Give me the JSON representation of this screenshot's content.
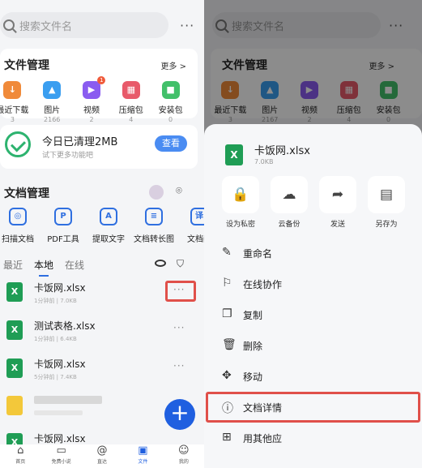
{
  "left": {
    "search_placeholder": "搜索文件名",
    "more_dots": "···",
    "file_mgmt": {
      "title": "文件管理",
      "more": "更多 >",
      "tiles": [
        {
          "label": "最近下载",
          "count": "3",
          "color": "#f08a3a",
          "icon": "download-icon",
          "glyph": "↓"
        },
        {
          "label": "图片",
          "count": "2166",
          "color": "#3a9ef0",
          "icon": "image-icon",
          "glyph": "▲"
        },
        {
          "label": "视频",
          "count": "2",
          "color": "#8a5cf0",
          "icon": "play-icon",
          "glyph": "▶",
          "badge": "1"
        },
        {
          "label": "压缩包",
          "count": "4",
          "color": "#e85a6a",
          "icon": "zip-icon",
          "glyph": "▦"
        },
        {
          "label": "安装包",
          "count": "0",
          "color": "#42c06a",
          "icon": "package-icon",
          "glyph": "■"
        }
      ]
    },
    "clean": {
      "title": "今日已清理2MB",
      "subtitle": "试下更多功能吧",
      "button": "查看"
    },
    "doc_mgmt": {
      "title": "文档管理",
      "tools": [
        {
          "label": "扫描文档",
          "icon": "camera-icon",
          "glyph": "◎"
        },
        {
          "label": "PDF工具",
          "icon": "pdf-icon",
          "glyph": "P"
        },
        {
          "label": "提取文字",
          "icon": "text-extract-icon",
          "glyph": "A"
        },
        {
          "label": "文档转长图",
          "icon": "doc-to-image-icon",
          "glyph": "≡"
        },
        {
          "label": "文档翻",
          "icon": "translate-icon",
          "glyph": "译"
        }
      ]
    },
    "tabs": [
      "最近",
      "本地",
      "在线"
    ],
    "files": [
      {
        "name": "卡饭网.xlsx",
        "meta": "1分钟前  |  7.0KB"
      },
      {
        "name": "测试表格.xlsx",
        "meta": "1分钟前  |  6.4KB"
      },
      {
        "name": "卡饭网.xlsx",
        "meta": "5分钟前  |  7.4KB"
      },
      {
        "name": "",
        "meta": ""
      },
      {
        "name": "卡饭网.xlsx",
        "meta": ""
      }
    ],
    "row_dots": "···",
    "fab": "+",
    "nav": [
      {
        "label": "首页",
        "icon": "home-icon",
        "glyph": "⌂"
      },
      {
        "label": "免费小说",
        "icon": "book-icon",
        "glyph": "▭"
      },
      {
        "label": "直达",
        "icon": "direct-icon",
        "glyph": "@"
      },
      {
        "label": "文件",
        "icon": "file-icon",
        "glyph": "▣",
        "active": true
      },
      {
        "label": "我的",
        "icon": "profile-icon",
        "glyph": "☺"
      }
    ]
  },
  "right": {
    "search_placeholder": "搜索文件名",
    "more_dots": "···",
    "file_mgmt_title": "文件管理",
    "more": "更多 >",
    "tiles": [
      {
        "label": "最近下载",
        "count": "3"
      },
      {
        "label": "图片",
        "count": "2167"
      },
      {
        "label": "视频",
        "count": "2"
      },
      {
        "label": "压缩包",
        "count": "4"
      },
      {
        "label": "安装包",
        "count": "0"
      }
    ],
    "sheet": {
      "file_name": "卡饭网.xlsx",
      "file_size": "7.0KB",
      "actions": [
        {
          "label": "设为私密",
          "icon": "lock-icon",
          "glyph": "🔒"
        },
        {
          "label": "云备份",
          "icon": "cloud-upload-icon",
          "glyph": "☁"
        },
        {
          "label": "发送",
          "icon": "share-icon",
          "glyph": "➦"
        },
        {
          "label": "另存为",
          "icon": "save-icon",
          "glyph": "▤"
        }
      ],
      "menu": [
        {
          "label": "重命名",
          "icon": "rename-icon",
          "glyph": "✎"
        },
        {
          "label": "在线协作",
          "icon": "collaborate-icon",
          "glyph": "⚐"
        },
        {
          "label": "复制",
          "icon": "copy-icon",
          "glyph": "❐"
        },
        {
          "label": "删除",
          "icon": "trash-icon",
          "glyph": "🗑"
        },
        {
          "label": "移动",
          "icon": "move-icon",
          "glyph": "✥"
        },
        {
          "label": "文档详情",
          "icon": "info-icon",
          "glyph": "ⓘ"
        },
        {
          "label": "用其他应",
          "icon": "apps-icon",
          "glyph": "⊞"
        }
      ]
    }
  },
  "colors": {
    "accent": "#1f5fe0",
    "highlight": "#e0504a",
    "excel": "#1f9d55",
    "success": "#2db36f"
  }
}
